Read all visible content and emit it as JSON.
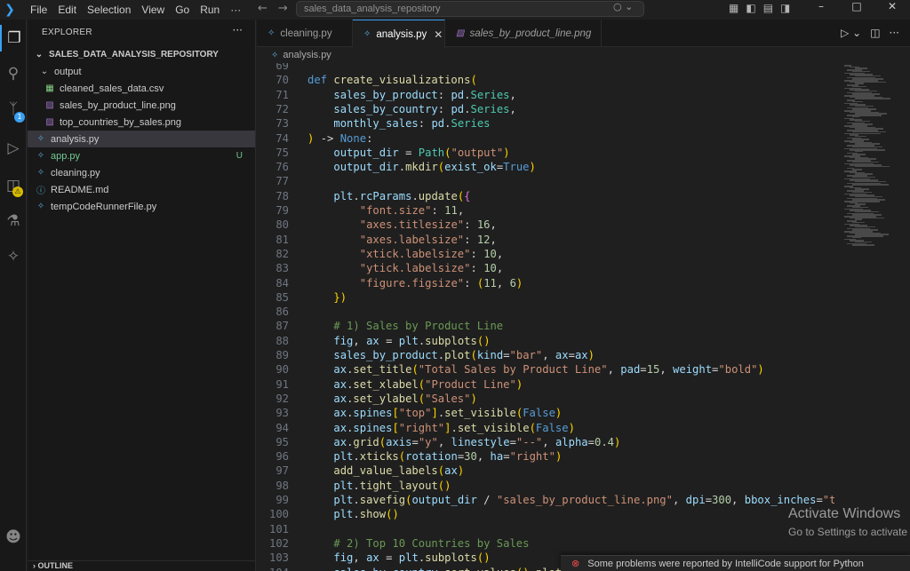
{
  "menu": [
    "File",
    "Edit",
    "Selection",
    "View",
    "Go",
    "Run",
    "···"
  ],
  "command_center": "sales_data_analysis_repository",
  "window_controls": [
    "–",
    "□",
    "✕"
  ],
  "activity_badges": {
    "source_control": "1",
    "extensions": "⚠"
  },
  "explorer": {
    "title": "EXPLORER",
    "more": "···",
    "root": "SALES_DATA_ANALYSIS_REPOSITORY",
    "items": [
      {
        "label": "output",
        "icon": "chevron-down",
        "kind": "folder"
      },
      {
        "label": "cleaned_sales_data.csv",
        "icon": "csv",
        "kind": "file"
      },
      {
        "label": "sales_by_product_line.png",
        "icon": "image",
        "kind": "file"
      },
      {
        "label": "top_countries_by_sales.png",
        "icon": "image",
        "kind": "file"
      },
      {
        "label": "analysis.py",
        "icon": "python",
        "kind": "file",
        "selected": true
      },
      {
        "label": "app.py",
        "icon": "python",
        "kind": "file",
        "status": "U"
      },
      {
        "label": "cleaning.py",
        "icon": "python",
        "kind": "file"
      },
      {
        "label": "README.md",
        "icon": "info",
        "kind": "file"
      },
      {
        "label": "tempCodeRunnerFile.py",
        "icon": "python",
        "kind": "file"
      }
    ],
    "outline": "OUTLINE"
  },
  "tabs": [
    {
      "label": "cleaning.py",
      "active": false
    },
    {
      "label": "analysis.py",
      "active": true
    },
    {
      "label": "sales_by_product_line.png",
      "active": false
    }
  ],
  "breadcrumb": "analysis.py",
  "code_lines": [
    {
      "n": "69",
      "t": ""
    },
    {
      "n": "70",
      "t": "def create_visualizations("
    },
    {
      "n": "71",
      "t": "    sales_by_product: pd.Series,"
    },
    {
      "n": "72",
      "t": "    sales_by_country: pd.Series,"
    },
    {
      "n": "73",
      "t": "    monthly_sales: pd.Series"
    },
    {
      "n": "74",
      "t": ") -> None:"
    },
    {
      "n": "75",
      "t": "    output_dir = Path(\"output\")"
    },
    {
      "n": "76",
      "t": "    output_dir.mkdir(exist_ok=True)"
    },
    {
      "n": "77",
      "t": ""
    },
    {
      "n": "78",
      "t": "    plt.rcParams.update({"
    },
    {
      "n": "79",
      "t": "        \"font.size\": 11,"
    },
    {
      "n": "80",
      "t": "        \"axes.titlesize\": 16,"
    },
    {
      "n": "81",
      "t": "        \"axes.labelsize\": 12,"
    },
    {
      "n": "82",
      "t": "        \"xtick.labelsize\": 10,"
    },
    {
      "n": "83",
      "t": "        \"ytick.labelsize\": 10,"
    },
    {
      "n": "84",
      "t": "        \"figure.figsize\": (11, 6)"
    },
    {
      "n": "85",
      "t": "    })"
    },
    {
      "n": "86",
      "t": ""
    },
    {
      "n": "87",
      "t": "    # 1) Sales by Product Line"
    },
    {
      "n": "88",
      "t": "    fig, ax = plt.subplots()"
    },
    {
      "n": "89",
      "t": "    sales_by_product.plot(kind=\"bar\", ax=ax)"
    },
    {
      "n": "90",
      "t": "    ax.set_title(\"Total Sales by Product Line\", pad=15, weight=\"bold\")"
    },
    {
      "n": "91",
      "t": "    ax.set_xlabel(\"Product Line\")"
    },
    {
      "n": "92",
      "t": "    ax.set_ylabel(\"Sales\")"
    },
    {
      "n": "93",
      "t": "    ax.spines[\"top\"].set_visible(False)"
    },
    {
      "n": "94",
      "t": "    ax.spines[\"right\"].set_visible(False)"
    },
    {
      "n": "95",
      "t": "    ax.grid(axis=\"y\", linestyle=\"--\", alpha=0.4)"
    },
    {
      "n": "96",
      "t": "    plt.xticks(rotation=30, ha=\"right\")"
    },
    {
      "n": "97",
      "t": "    add_value_labels(ax)"
    },
    {
      "n": "98",
      "t": "    plt.tight_layout()"
    },
    {
      "n": "99",
      "t": "    plt.savefig(output_dir / \"sales_by_product_line.png\", dpi=300, bbox_inches=\"tight\")"
    },
    {
      "n": "100",
      "t": "    plt.show()"
    },
    {
      "n": "101",
      "t": ""
    },
    {
      "n": "102",
      "t": "    # 2) Top 10 Countries by Sales"
    },
    {
      "n": "103",
      "t": "    fig, ax = plt.subplots()"
    },
    {
      "n": "104",
      "t": "    sales_by_country.sort_values().plot(kin"
    }
  ],
  "watermark": {
    "title": "Activate Windows",
    "subtitle": "Go to Settings to activate"
  },
  "notification": {
    "text": "Some problems were reported by IntelliCode support for Python"
  },
  "colors": {
    "accent": "#3aa0f3",
    "background": "#1f1f1f",
    "sidebar": "#181818"
  }
}
